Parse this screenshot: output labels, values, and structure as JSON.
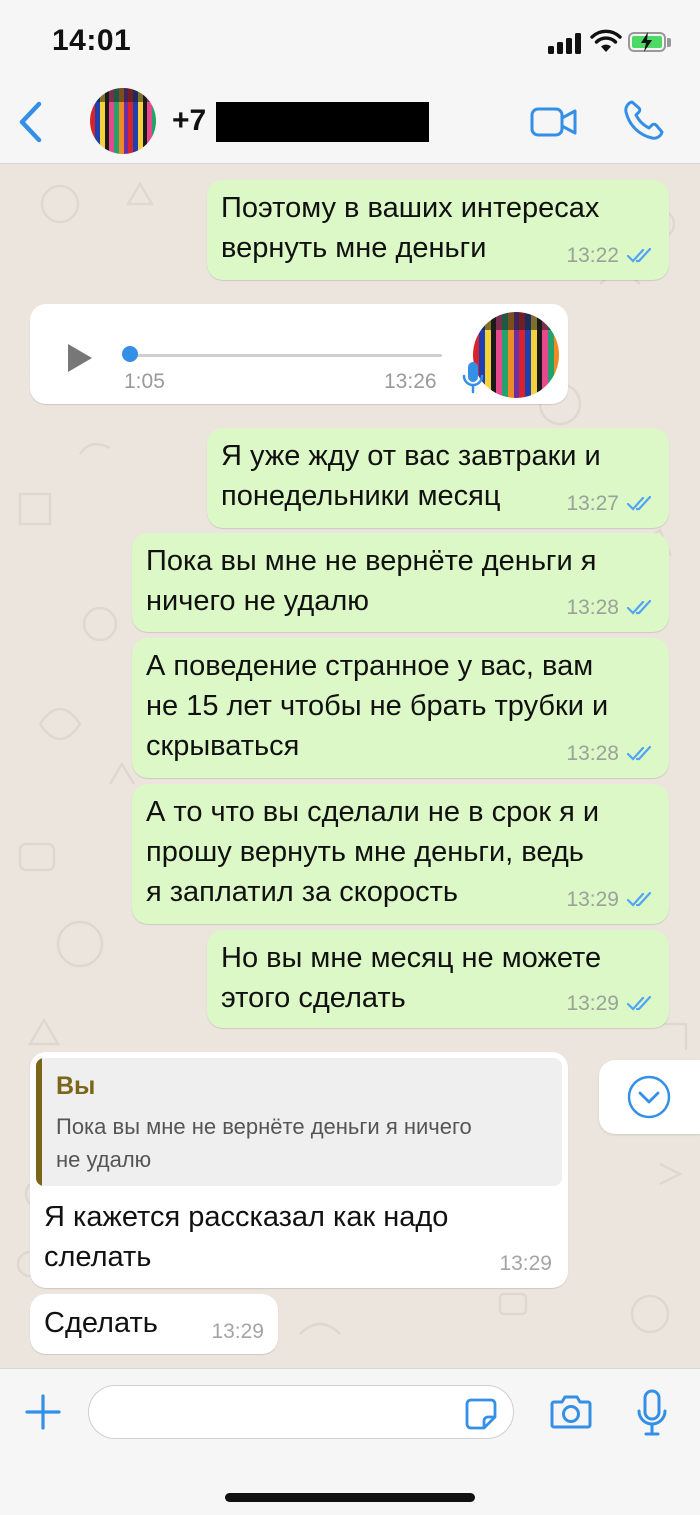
{
  "status_bar": {
    "time": "14:01"
  },
  "header": {
    "contact_name": "+7",
    "icons": [
      "back-chevron-icon",
      "avatar",
      "video-call-icon",
      "phone-call-icon"
    ]
  },
  "colors": {
    "accent": "#3490e6",
    "outgoing_bubble": "#dcf8c6",
    "incoming_bubble": "#ffffff",
    "chat_background": "#ece5dd",
    "quote_accent": "#7a6519",
    "read_ticks": "#4fa5f5"
  },
  "messages": [
    {
      "direction": "out",
      "text": "Поэтому в ваших интересах\nвернуть мне деньги",
      "time": "13:22",
      "status": "read"
    },
    {
      "direction": "in",
      "type": "voice",
      "duration": "1:05",
      "time": "13:26",
      "progress": 0
    },
    {
      "direction": "out",
      "text": "Я уже жду от вас завтраки и\nпонедельники месяц",
      "time": "13:27",
      "status": "read"
    },
    {
      "direction": "out",
      "text": "Пока вы мне не вернёте деньги я\nничего не удалю",
      "time": "13:28",
      "status": "read"
    },
    {
      "direction": "out",
      "text": "А поведение странное у вас, вам\nне 15 лет чтобы не брать трубки и\nскрываться",
      "time": "13:28",
      "status": "read"
    },
    {
      "direction": "out",
      "text": "А то что вы сделали не в срок я и\nпрошу вернуть мне деньги, ведь\nя заплатил за скорость",
      "time": "13:29",
      "status": "read"
    },
    {
      "direction": "out",
      "text": "Но вы мне месяц не можете\nэтого сделать",
      "time": "13:29",
      "status": "read"
    },
    {
      "direction": "in",
      "type": "reply",
      "quote_author": "Вы",
      "quote_text": "Пока вы мне не вернёте деньги я ничего\nне удалю",
      "text": "Я кажется рассказал как надо\nслелать",
      "time": "13:29"
    },
    {
      "direction": "in",
      "text": "Сделать",
      "time": "13:29"
    }
  ],
  "input": {
    "placeholder": "",
    "value": ""
  }
}
